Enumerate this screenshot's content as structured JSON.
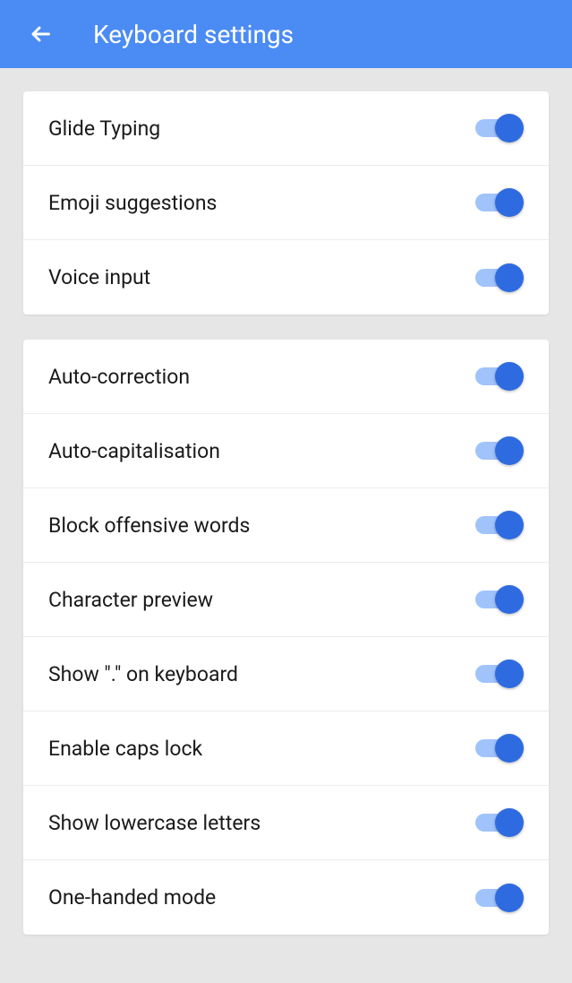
{
  "header": {
    "title": "Keyboard settings"
  },
  "groups": [
    {
      "items": [
        {
          "label": "Glide Typing",
          "on": true
        },
        {
          "label": "Emoji suggestions",
          "on": true
        },
        {
          "label": "Voice input",
          "on": true
        }
      ]
    },
    {
      "items": [
        {
          "label": "Auto-correction",
          "on": true
        },
        {
          "label": "Auto-capitalisation",
          "on": true
        },
        {
          "label": "Block offensive words",
          "on": true
        },
        {
          "label": "Character preview",
          "on": true
        },
        {
          "label": "Show \".\" on keyboard",
          "on": true
        },
        {
          "label": "Enable caps lock",
          "on": true
        },
        {
          "label": "Show lowercase letters",
          "on": true
        },
        {
          "label": "One-handed mode",
          "on": true
        }
      ]
    }
  ]
}
